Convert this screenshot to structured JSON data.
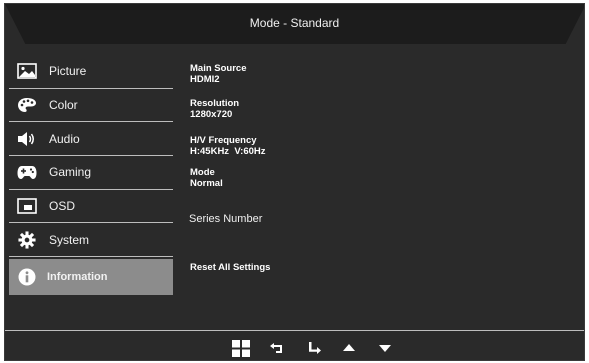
{
  "header": {
    "title": "Mode - Standard"
  },
  "menu": {
    "items": [
      {
        "label": "Picture",
        "icon": "picture-icon"
      },
      {
        "label": "Color",
        "icon": "palette-icon"
      },
      {
        "label": "Audio",
        "icon": "speaker-icon"
      },
      {
        "label": "Gaming",
        "icon": "gamepad-icon"
      },
      {
        "label": "OSD",
        "icon": "osd-window-icon"
      },
      {
        "label": "System",
        "icon": "gear-icon"
      },
      {
        "label": "Information",
        "icon": "info-icon",
        "selected": true
      }
    ]
  },
  "info": {
    "main_source_label": "Main Source",
    "main_source_value": "HDMI2",
    "resolution_label": "Resolution",
    "resolution_value": "1280x720",
    "hv_label": "H/V Frequency",
    "hv_value": "H:45KHz  V:60Hz",
    "mode_label": "Mode",
    "mode_value": "Normal",
    "series_label": "Series Number",
    "reset_label": "Reset All Settings"
  },
  "navigation": {
    "icons": [
      "menu-grid-icon",
      "back-icon",
      "enter-icon",
      "up-arrow-icon",
      "down-arrow-icon"
    ]
  },
  "colors": {
    "background": "#2a2a2a",
    "header": "#1c1c1c",
    "selected": "#8c8c8c",
    "divider": "#bdbdbd"
  }
}
